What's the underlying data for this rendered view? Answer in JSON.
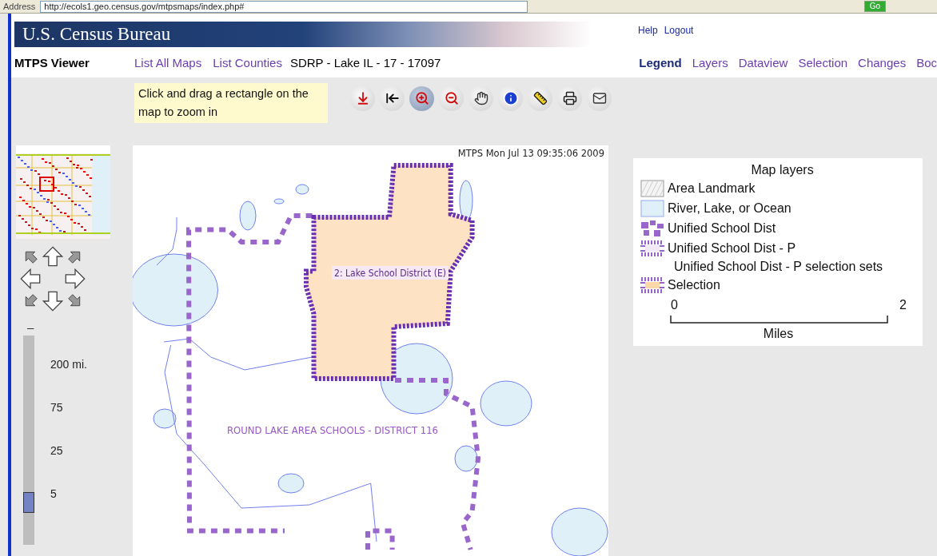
{
  "address_bar": {
    "label": "Address",
    "url": "http://ecols1.geo.census.gov/mtpsmaps/index.php#",
    "go": "Go"
  },
  "header": {
    "title": "U.S. Census Bureau",
    "links": [
      "Help",
      "Logout"
    ]
  },
  "nav": {
    "app_name": "MTPS Viewer",
    "links": [
      "List All Maps",
      "List Counties"
    ],
    "context": "SDRP - Lake IL - 17 - 17097",
    "tabs": [
      {
        "label": "Legend",
        "selected": true
      },
      {
        "label": "Layers",
        "selected": false
      },
      {
        "label": "Dataview",
        "selected": false
      },
      {
        "label": "Selection",
        "selected": false
      },
      {
        "label": "Changes",
        "selected": false
      },
      {
        "label": "Boc",
        "selected": false
      }
    ]
  },
  "toolbar": {
    "hint": "Click and drag a rectangle on the map to zoom in",
    "tools": [
      {
        "kind": "full-extent",
        "selected": false
      },
      {
        "kind": "back",
        "selected": false
      },
      {
        "kind": "zoom-in",
        "selected": true
      },
      {
        "kind": "zoom-out",
        "selected": false
      },
      {
        "kind": "pan",
        "selected": false
      },
      {
        "kind": "info",
        "selected": false
      },
      {
        "kind": "measure",
        "selected": false
      },
      {
        "kind": "print",
        "selected": false
      },
      {
        "kind": "email",
        "selected": false
      }
    ]
  },
  "zoom_slider": {
    "minus": "–",
    "level": 0.2,
    "labels": [
      "200 mi.",
      "75",
      "25",
      "5"
    ]
  },
  "map": {
    "timestamp": "MTPS Mon Jul 13 09:35:06 2009",
    "labels": [
      {
        "kind": "selected-district",
        "text": "2: Lake School District (E)"
      },
      {
        "kind": "district",
        "text": "ROUND LAKE AREA SCHOOLS - DISTRICT 116"
      }
    ]
  },
  "legend": {
    "title": "Map layers",
    "items": [
      {
        "kind": "landmark",
        "label": "Area Landmark"
      },
      {
        "kind": "water",
        "label": "River, Lake, or Ocean"
      },
      {
        "kind": "school-dist",
        "label": "Unified School Dist"
      },
      {
        "kind": "school-dist-p",
        "label": "Unified School Dist - P"
      },
      {
        "kind": "heading",
        "label": "Unified School Dist - P selection sets"
      },
      {
        "kind": "selection",
        "label": "Selection"
      }
    ],
    "scale": {
      "start": "0",
      "end": "2",
      "unit": "Miles"
    }
  }
}
